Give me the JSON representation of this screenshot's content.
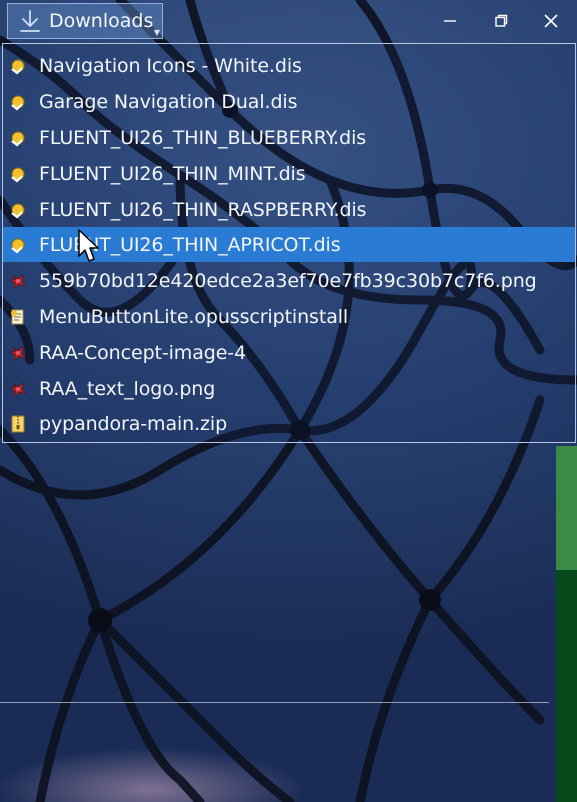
{
  "header": {
    "downloads_label": "Downloads",
    "icons": {
      "downloads": "download-arrow-icon",
      "dropdown": "chevron-down-icon",
      "minimize": "minimize-icon",
      "restore": "restore-icon",
      "close": "close-icon"
    }
  },
  "menu": {
    "items": [
      {
        "label": "Navigation Icons - White.dis",
        "icon": "dis-file-icon"
      },
      {
        "label": "Garage Navigation Dual.dis",
        "icon": "dis-file-icon"
      },
      {
        "label": "FLUENT_UI26_THIN_BLUEBERRY.dis",
        "icon": "dis-file-icon"
      },
      {
        "label": "FLUENT_UI26_THIN_MINT.dis",
        "icon": "dis-file-icon"
      },
      {
        "label": "FLUENT_UI26_THIN_RASPBERRY.dis",
        "icon": "dis-file-icon"
      },
      {
        "label": "FLUENT_UI26_THIN_APRICOT.dis",
        "icon": "dis-file-icon",
        "selected": true
      },
      {
        "label": "559b70bd12e420edce2a3ef70e7fb39c30b7c7f6.png",
        "icon": "image-file-icon"
      },
      {
        "label": "MenuButtonLite.opusscriptinstall",
        "icon": "script-file-icon"
      },
      {
        "label": "RAA-Concept-image-4",
        "icon": "image-file-icon"
      },
      {
        "label": "RAA_text_logo.png",
        "icon": "image-file-icon"
      },
      {
        "label": "pypandora-main.zip",
        "icon": "zip-file-icon"
      }
    ]
  },
  "colors": {
    "selection": "#2a7bd3",
    "scrollbar_track": "#064a1c",
    "scrollbar_thumb": "#3a8b45"
  }
}
